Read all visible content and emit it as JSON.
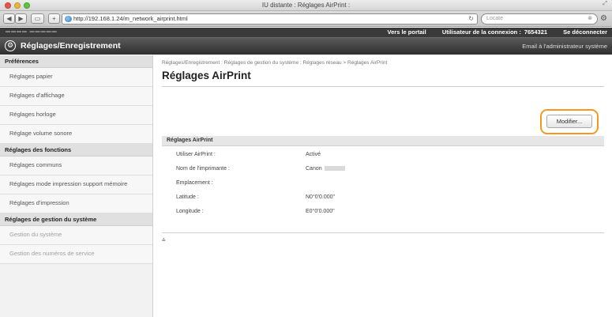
{
  "window": {
    "title": "IU distante : Réglages AirPrint :",
    "url": "http://192.168.1.24/m_network_airprint.html",
    "search_placeholder": "Locate"
  },
  "topbar": {
    "portal_link": "Vers le portail",
    "user_label": "Utilisateur de la connexion :",
    "user_value": "7654321",
    "logout": "Se déconnecter"
  },
  "header": {
    "title": "Réglages/Enregistrement",
    "mail_link": "Email à l'administrateur système"
  },
  "sidebar": {
    "sections": [
      {
        "title": "Préférences",
        "items": [
          "Réglages papier",
          "Réglages d'affichage",
          "Réglages horloge",
          "Réglage volume sonore"
        ]
      },
      {
        "title": "Réglages des fonctions",
        "items": [
          "Réglages communs",
          "Réglages mode impression support mémoire",
          "Réglages d'impression"
        ]
      },
      {
        "title": "Réglages de gestion du système",
        "items": [
          "Gestion du système",
          "Gestion des numéros de service"
        ]
      }
    ]
  },
  "main": {
    "breadcrumb": "Réglages/Enregistrement : Réglages de gestion du système : Réglages réseau > Réglages AirPrint",
    "title": "Réglages AirPrint",
    "edit_button": "Modifier...",
    "section_title": "Réglages AirPrint",
    "rows": [
      {
        "label": "Utiliser AirPrint :",
        "value": "Activé"
      },
      {
        "label": "Nom de l'imprimante :",
        "value": "Canon"
      },
      {
        "label": "Emplacement :",
        "value": ""
      },
      {
        "label": "Latitude :",
        "value": "N0°0'0.000\""
      },
      {
        "label": "Longitude :",
        "value": "E0°0'0.000\""
      }
    ]
  }
}
